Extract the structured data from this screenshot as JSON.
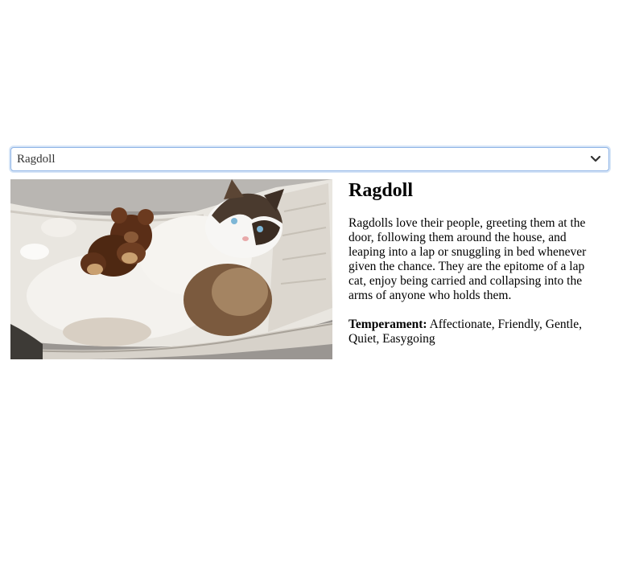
{
  "selector": {
    "selected_value": "Ragdoll"
  },
  "icons": {
    "dropdown": "chevron-down-icon"
  },
  "breed": {
    "name": "Ragdoll",
    "description": "Ragdolls love their people, greeting them at the door, following them around the house, and leaping into a lap or snuggling in bed whenever given the chance. They are the epitome of a lap cat, enjoy being carried and collapsing into the arms of anyone who holds them.",
    "temperament_label": "Temperament:",
    "temperament_value": "Affectionate, Friendly, Gentle, Quiet, Easygoing"
  }
}
